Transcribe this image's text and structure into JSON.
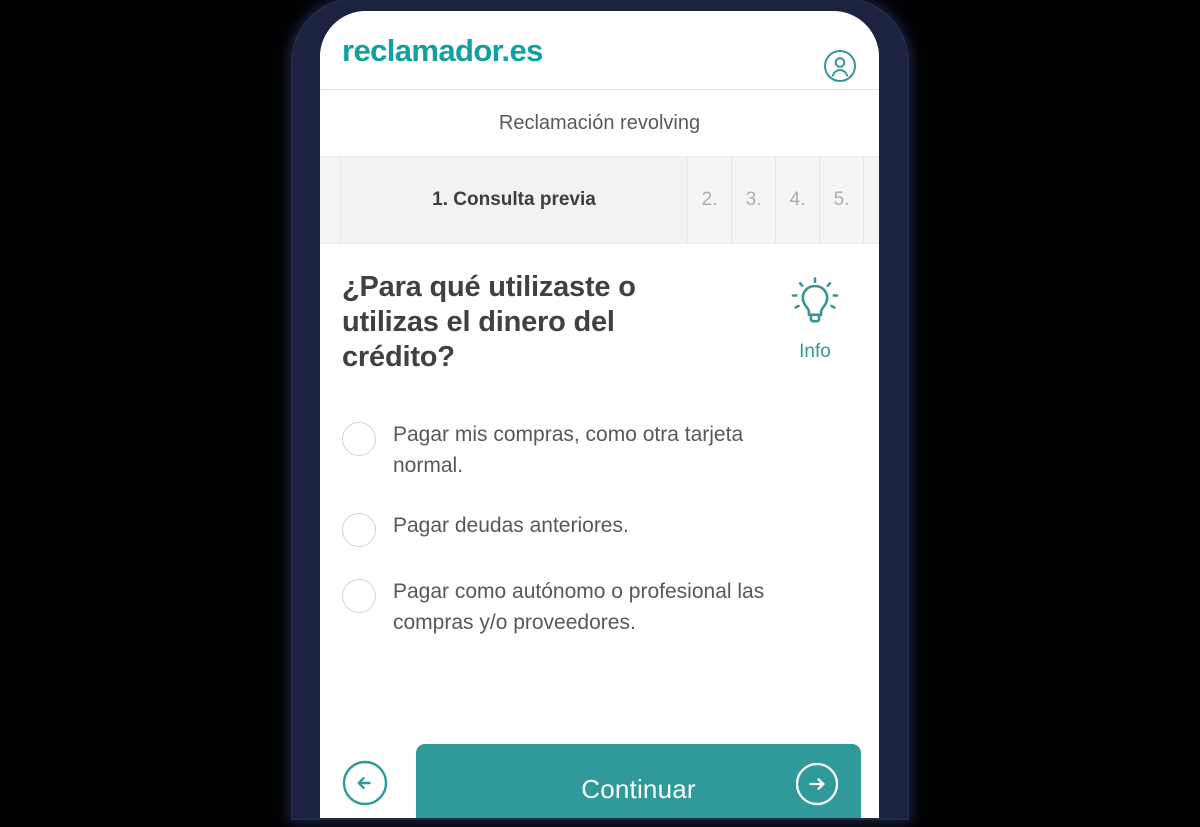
{
  "theme": {
    "brand_teal": "#11a0a0",
    "button_teal": "#2f9a99",
    "info_teal": "#3a9494",
    "frame_navy": "#1b2340",
    "text_dark": "#3f4143",
    "text_body": "#565859",
    "step_inactive": "#adaeb2"
  },
  "topbar": {
    "brand": "reclamador.es",
    "account_icon": "account-circle-icon"
  },
  "claim": {
    "title": "Reclamación revolving"
  },
  "stepper": {
    "steps": [
      {
        "label": "1. Consulta previa",
        "active": true
      },
      {
        "label": "2.",
        "active": false
      },
      {
        "label": "3.",
        "active": false
      },
      {
        "label": "4.",
        "active": false
      },
      {
        "label": "5.",
        "active": false
      },
      {
        "label": "",
        "active": false
      }
    ]
  },
  "question": {
    "text": "¿Para qué utilizaste o utilizas el dinero del crédito?",
    "info": {
      "icon": "lightbulb-icon",
      "label": "Info"
    }
  },
  "options": [
    {
      "label": "Pagar mis compras, como otra tarjeta normal.",
      "selected": false
    },
    {
      "label": "Pagar deudas anteriores.",
      "selected": false
    },
    {
      "label": "Pagar como autónomo o profesional las compras y/o proveedores.",
      "selected": false
    }
  ],
  "footer": {
    "back_icon": "arrow-left-circle-icon",
    "continue_label": "Continuar",
    "continue_icon": "arrow-right-circle-icon"
  }
}
